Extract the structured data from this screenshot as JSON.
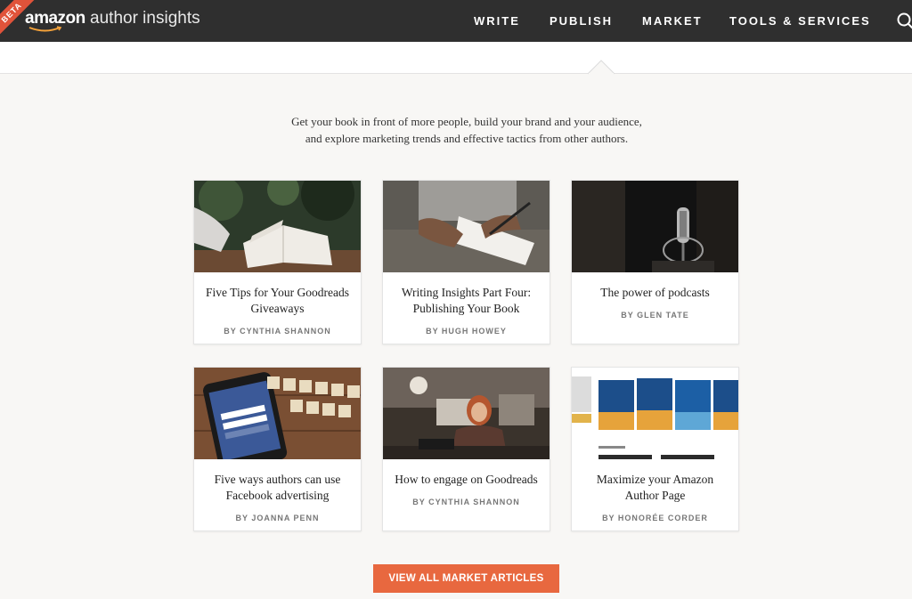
{
  "header": {
    "beta_badge": "BETA",
    "logo_brand": "amazon",
    "logo_suffix": "author insights",
    "nav": [
      {
        "label": "WRITE"
      },
      {
        "label": "PUBLISH"
      },
      {
        "label": "MARKET"
      },
      {
        "label": "TOOLS & SERVICES"
      }
    ],
    "search_icon": "search-icon"
  },
  "intro": {
    "line1": "Get your book in front of more people, build your brand and your audience,",
    "line2": "and explore marketing trends and effective tactics from other authors."
  },
  "cards": [
    {
      "title": "Five Tips for Your Goodreads Giveaways",
      "author": "BY CYNTHIA SHANNON",
      "image": "open-book-photo"
    },
    {
      "title": "Writing Insights Part Four: Publishing Your Book",
      "author": "BY HUGH HOWEY",
      "image": "writing-notebook-photo"
    },
    {
      "title": "The power of podcasts",
      "author": "BY GLEN TATE",
      "image": "studio-microphone-photo"
    },
    {
      "title": "Five ways authors can use Facebook advertising",
      "author": "BY JOANNA PENN",
      "image": "facebook-phone-photo"
    },
    {
      "title": "How to engage on Goodreads",
      "author": "BY CYNTHIA SHANNON",
      "image": "woman-laptop-photo"
    },
    {
      "title": "Maximize your Amazon Author Page",
      "author": "BY HONORÉE CORDER",
      "image": "author-page-screenshot"
    }
  ],
  "cta": {
    "label": "VIEW ALL MARKET ARTICLES"
  },
  "colors": {
    "header_bg": "#2f2f2f",
    "accent": "#e8683f",
    "page_bg": "#f8f7f5"
  }
}
